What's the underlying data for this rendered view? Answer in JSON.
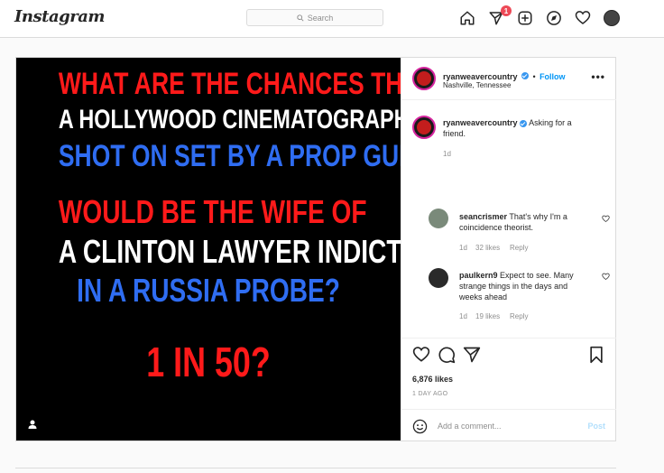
{
  "header": {
    "logo": "Instagram",
    "search_placeholder": "Search",
    "notification_count": "1"
  },
  "post": {
    "image_text": {
      "line1": "WHAT ARE THE CHANCES THAT",
      "line2": "A HOLLYWOOD CINEMATOGRAPHER",
      "line3": "SHOT ON SET BY A PROP GUN",
      "line4": "WOULD BE THE WIFE OF",
      "line5": "A CLINTON LAWYER INDICTED",
      "line6": "IN A RUSSIA PROBE?",
      "line7": "1 IN 50?"
    },
    "author": {
      "username": "ryanweavercountry",
      "follow_label": "Follow",
      "separator": "•",
      "location": "Nashville, Tennessee"
    },
    "more_label": "•••",
    "caption": {
      "username": "ryanweavercountry",
      "text": "Asking for a friend.",
      "time": "1d"
    },
    "comments": [
      {
        "username": "seancrismer",
        "text": "That's why I'm a coincidence theorist.",
        "time": "1d",
        "likes": "32 likes",
        "reply": "Reply"
      },
      {
        "username": "paulkern9",
        "text": "Expect to see. Many strange things in the days and weeks ahead",
        "time": "1d",
        "likes": "19 likes",
        "reply": "Reply"
      }
    ],
    "likes_count": "6,876 likes",
    "posted_ago": "1 DAY AGO",
    "add_comment_placeholder": "Add a comment...",
    "post_button": "Post"
  },
  "colors": {
    "accent": "#0095f6",
    "red_text": "#ff1a1a",
    "blue_text": "#2f6df2",
    "badge": "#ed4956"
  },
  "icons": [
    "search-icon",
    "home-icon",
    "messenger-icon",
    "new-post-icon",
    "explore-icon",
    "heart-icon",
    "comment-icon",
    "share-icon",
    "bookmark-icon",
    "emoji-icon",
    "user-tag-icon"
  ]
}
